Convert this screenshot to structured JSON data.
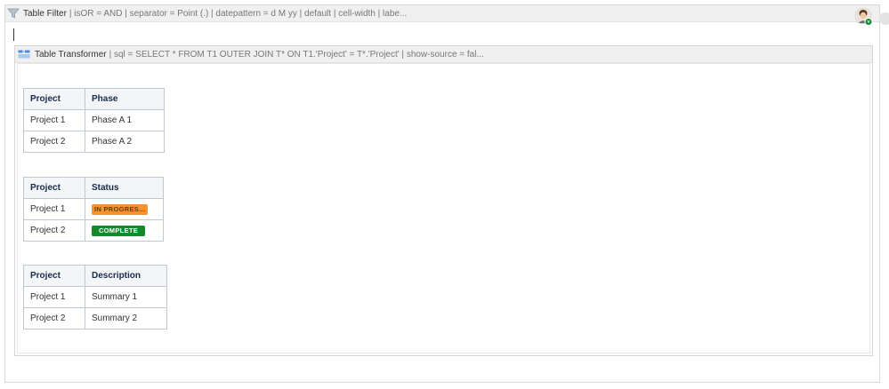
{
  "filter_macro": {
    "name": "Table Filter",
    "params": "| isOR = AND | separator = Point (.) | datepattern = d M yy | default | cell-width | labe..."
  },
  "transformer_macro": {
    "name": "Table Transformer",
    "params": "| sql = SELECT * FROM T1 OUTER JOIN T* ON T1.'Project' = T*.'Project' | show-source = fal..."
  },
  "tables": [
    {
      "headers": [
        "Project",
        "Phase"
      ],
      "rows": [
        [
          "Project 1",
          "Phase A 1"
        ],
        [
          "Project 2",
          "Phase A 2"
        ]
      ]
    },
    {
      "headers": [
        "Project",
        "Status"
      ],
      "rows": [
        [
          "Project 1",
          "IN PROGRES..."
        ],
        [
          "Project 2",
          "COMPLETE"
        ]
      ]
    },
    {
      "headers": [
        "Project",
        "Description"
      ],
      "rows": [
        [
          "Project 1",
          "Summary 1"
        ],
        [
          "Project 2",
          "Summary 2"
        ]
      ]
    }
  ],
  "colors": {
    "status_in_progress": "#f79232",
    "status_complete": "#14892c",
    "table_header_bg": "#f4f5f7",
    "table_border": "#c1c7d0"
  },
  "icons": {
    "filter": "funnel-icon",
    "transformer": "table-transformer-icon",
    "avatar": "user-avatar"
  }
}
